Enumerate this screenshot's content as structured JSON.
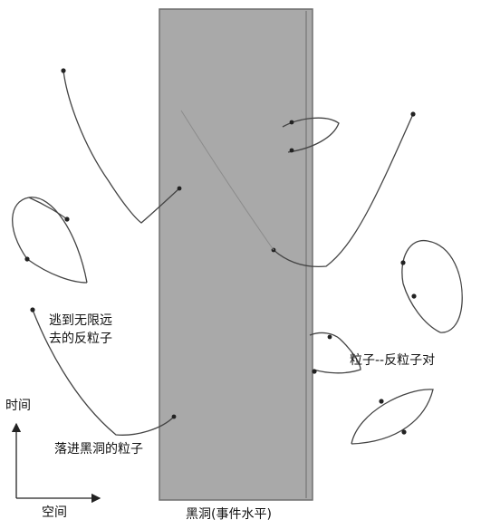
{
  "labels": {
    "escaped_antiparticle_line1": "逃到无限远",
    "escaped_antiparticle_line2": "去的反粒子",
    "particle_antiparticle_pair": "粒子--反粒子对",
    "particle_falling_in": "落进黑洞的粒子",
    "black_hole": "黑洞(事件水平)",
    "time_axis": "时间",
    "space_axis": "空间"
  },
  "colors": {
    "black_hole_fill": "#a9a9a9",
    "black_hole_edge": "#6f6f6f",
    "curve_stroke": "#444444",
    "dot": "#222222"
  }
}
